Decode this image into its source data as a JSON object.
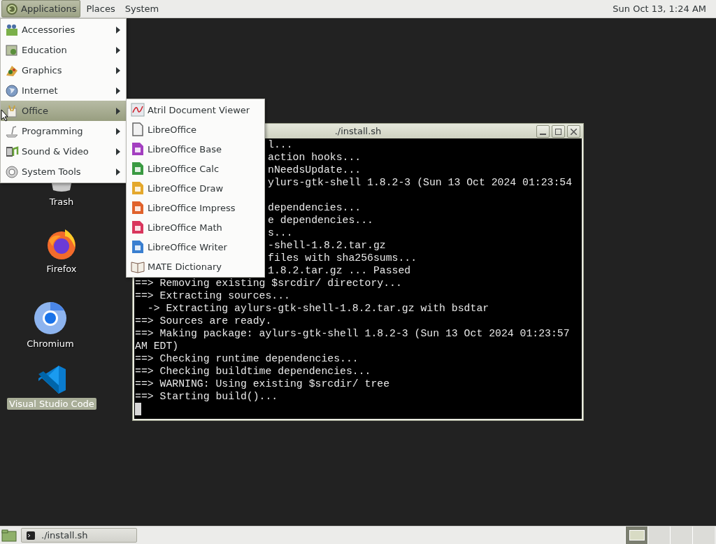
{
  "top_panel": {
    "menus": [
      {
        "label": "Applications",
        "selected": true
      },
      {
        "label": "Places",
        "selected": false
      },
      {
        "label": "System",
        "selected": false
      }
    ],
    "clock": "Sun Oct 13, 1:24 AM"
  },
  "applications_menu": {
    "items": [
      {
        "label": "Accessories",
        "selected": false
      },
      {
        "label": "Education",
        "selected": false
      },
      {
        "label": "Graphics",
        "selected": false
      },
      {
        "label": "Internet",
        "selected": false
      },
      {
        "label": "Office",
        "selected": true
      },
      {
        "label": "Programming",
        "selected": false
      },
      {
        "label": "Sound & Video",
        "selected": false
      },
      {
        "label": "System Tools",
        "selected": false
      }
    ]
  },
  "office_submenu": {
    "items": [
      "Atril Document Viewer",
      "LibreOffice",
      "LibreOffice Base",
      "LibreOffice Calc",
      "LibreOffice Draw",
      "LibreOffice Impress",
      "LibreOffice Math",
      "LibreOffice Writer",
      "MATE Dictionary"
    ]
  },
  "desktop_icons": [
    {
      "label": "Trash",
      "selected": false
    },
    {
      "label": "Firefox",
      "selected": false
    },
    {
      "label": "Chromium",
      "selected": false
    },
    {
      "label": "Visual Studio Code",
      "selected": true
    }
  ],
  "terminal": {
    "title": "./install.sh",
    "lines": [
      {
        "kind": "covered",
        "text": "l..."
      },
      {
        "kind": "covered",
        "text": "action hooks..."
      },
      {
        "kind": "covered",
        "text": "nNeedsUpdate..."
      },
      {
        "kind": "covered",
        "text": "ylurs-gtk-shell 1.8.2-3 (Sun 13 Oct 2024 01:23:54"
      },
      {
        "kind": "blank"
      },
      {
        "kind": "covered",
        "text": "dependencies..."
      },
      {
        "kind": "covered",
        "text": "e dependencies..."
      },
      {
        "kind": "covered",
        "text": "s..."
      },
      {
        "kind": "covered",
        "text": "-shell-1.8.2.tar.gz"
      },
      {
        "kind": "covered",
        "text": "files with sha256sums..."
      },
      {
        "kind": "covered",
        "text": "1.8.2.tar.gz ... Passed"
      },
      {
        "kind": "full",
        "text": "==> Removing existing $srcdir/ directory..."
      },
      {
        "kind": "full",
        "text": "==> Extracting sources..."
      },
      {
        "kind": "full",
        "text": "  -> Extracting aylurs-gtk-shell-1.8.2.tar.gz with bsdtar"
      },
      {
        "kind": "full",
        "text": "==> Sources are ready."
      },
      {
        "kind": "full",
        "text": "==> Making package: aylurs-gtk-shell 1.8.2-3 (Sun 13 Oct 2024 01:23:57"
      },
      {
        "kind": "full",
        "text": "AM EDT)"
      },
      {
        "kind": "full",
        "text": "==> Checking runtime dependencies..."
      },
      {
        "kind": "full",
        "text": "==> Checking buildtime dependencies..."
      },
      {
        "kind": "full",
        "text": "==> WARNING: Using existing $srcdir/ tree"
      },
      {
        "kind": "full",
        "text": "==> Starting build()..."
      }
    ]
  },
  "bottom_panel": {
    "tasks": [
      {
        "label": "./install.sh",
        "selected": false
      }
    ],
    "workspaces": [
      {
        "selected": true
      },
      {
        "selected": false
      },
      {
        "selected": false
      },
      {
        "selected": false
      }
    ]
  }
}
